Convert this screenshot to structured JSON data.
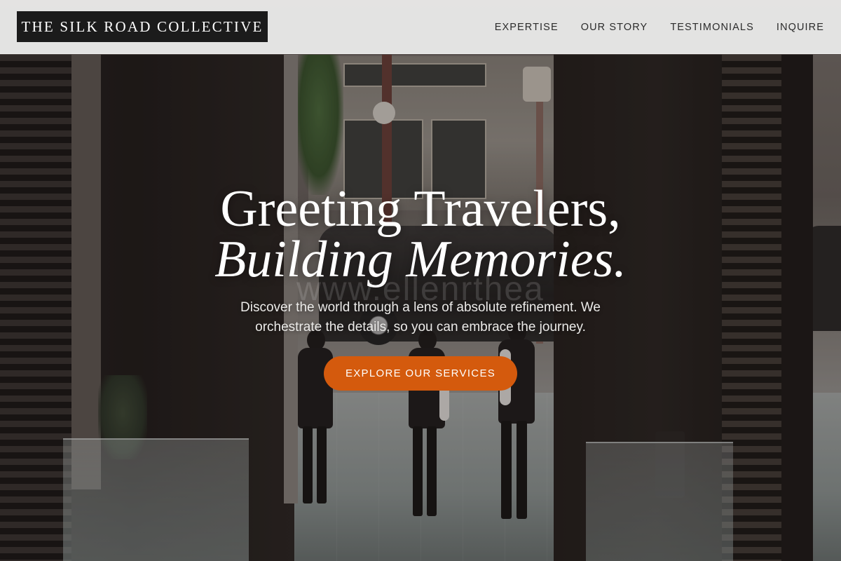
{
  "header": {
    "logo_text": "THE SILK ROAD COLLECTIVE",
    "nav": [
      {
        "label": "EXPERTISE"
      },
      {
        "label": "OUR STORY"
      },
      {
        "label": "TESTIMONIALS"
      },
      {
        "label": "INQUIRE"
      }
    ]
  },
  "hero": {
    "headline_line1": "Greeting Travelers,",
    "headline_line2": "Building Memories.",
    "watermark": "www.ellenrthea",
    "subtitle": "Discover the world through a lens of absolute refinement. We orchestrate the details, so you can embrace the journey.",
    "cta_label": "EXPLORE OUR SERVICES"
  },
  "colors": {
    "accent": "#d45a0d",
    "header_bg": "#ececeb",
    "logo_bg": "#1b1b1b"
  }
}
